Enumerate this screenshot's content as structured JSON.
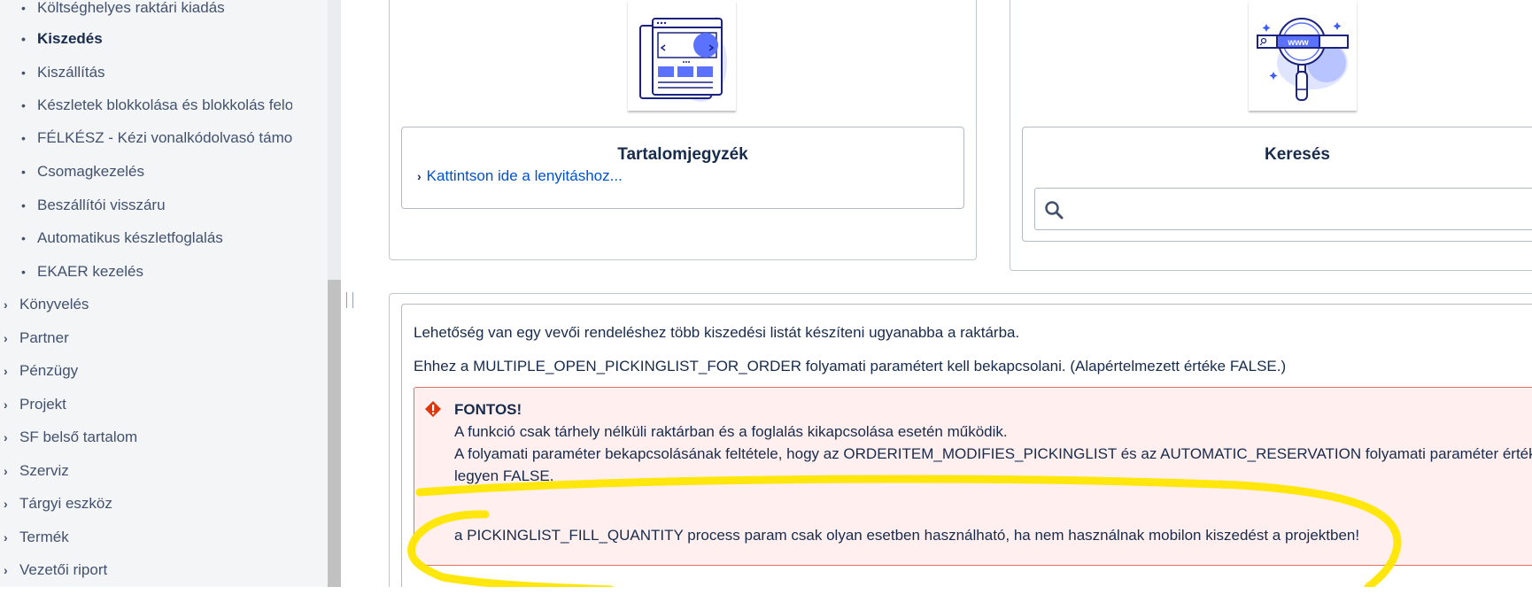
{
  "sidebar": {
    "sub_items": [
      {
        "label": "Költséghelyes raktári kiadás",
        "active": false
      },
      {
        "label": "Kiszedés",
        "active": true
      },
      {
        "label": "Kiszállítás",
        "active": false
      },
      {
        "label": "Készletek blokkolása és blokkolás felo",
        "active": false
      },
      {
        "label": "FÉLKÉSZ - Kézi vonalkódolvasó támog",
        "active": false
      },
      {
        "label": "Csomagkezelés",
        "active": false
      },
      {
        "label": "Beszállítói visszáru",
        "active": false
      },
      {
        "label": "Automatikus készletfoglalás",
        "active": false
      },
      {
        "label": "EKAER kezelés",
        "active": false
      }
    ],
    "top_items": [
      {
        "label": "Könyvelés"
      },
      {
        "label": "Partner"
      },
      {
        "label": "Pénzügy"
      },
      {
        "label": "Projekt"
      },
      {
        "label": "SF belső tartalom"
      },
      {
        "label": "Szerviz"
      },
      {
        "label": "Tárgyi eszköz"
      },
      {
        "label": "Termék"
      },
      {
        "label": "Vezetői riport"
      }
    ],
    "bullet": "•",
    "chevron": "›"
  },
  "toc_card": {
    "title": "Tartalomjegyzék",
    "link": "Kattintson ide a lenyitáshoz...",
    "icon": "website-layout-illustration"
  },
  "search_card": {
    "title": "Keresés",
    "icon": "magnifier-www-illustration",
    "search_value": "",
    "search_text": "www"
  },
  "content": {
    "para1": "Lehetőség van egy vevői rendeléshez több kiszedési listát készíteni ugyanabba a raktárba.",
    "para2": "Ehhez a MULTIPLE_OPEN_PICKINGLIST_FOR_ORDER folyamati paramétert kell bekapcsolani. (Alapértelmezett értéke FALSE.)",
    "alert": {
      "title": "FONTOS!",
      "line1": "A funkció csak tárhely nélküli raktárban és a foglalás kikapcsolása esetén működik.",
      "line2": "A folyamati paraméter bekapcsolásának feltétele, hogy az ORDERITEM_MODIFIES_PICKINGLIST és az AUTOMATIC_RESERVATION folyamati paraméter értéke",
      "line3": "legyen FALSE.",
      "line4": "a PICKINGLIST_FILL_QUANTITY process param  csak olyan esetben használható, ha nem használnak mobilon kiszedést a projektben!"
    }
  },
  "colors": {
    "link": "#0052cc",
    "alert_bg": "#fff0ef",
    "alert_border": "#e37166",
    "alert_icon": "#de350b",
    "highlight": "#ffe600",
    "illustration_blue": "#3d5afe"
  }
}
